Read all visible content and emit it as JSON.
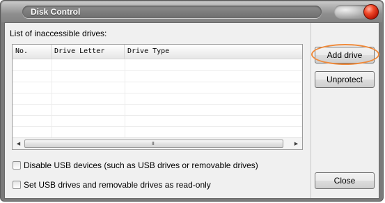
{
  "window": {
    "title": "Disk Control"
  },
  "list": {
    "label": "List of inaccessible drives:",
    "columns": [
      "No.",
      "Drive Letter",
      "Drive Type"
    ],
    "rows": [],
    "scrollbar": {
      "left_arrow": "◀",
      "right_arrow": "▶",
      "grip": "III"
    }
  },
  "options": {
    "disable_usb": {
      "label": "Disable USB devices (such as USB drives or removable drives)",
      "checked": false
    },
    "readonly_usb": {
      "label": "Set USB drives and removable drives as read-only",
      "checked": false
    }
  },
  "buttons": {
    "add_drive": "Add drive",
    "unprotect": "Unprotect",
    "close": "Close"
  },
  "colors": {
    "highlight": "#f08a3a",
    "close_gem": "#e0301a"
  }
}
